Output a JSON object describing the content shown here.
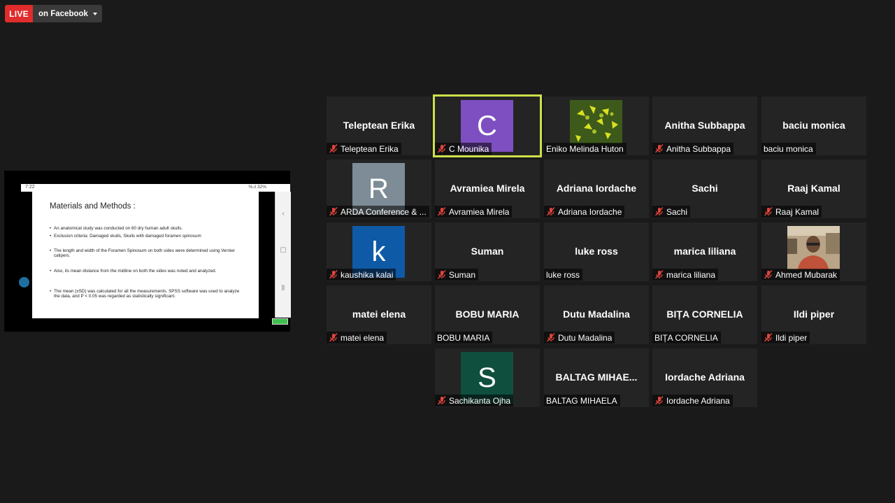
{
  "live": {
    "badge": "LIVE",
    "destination": "on Facebook"
  },
  "share": {
    "status_time": "7:22",
    "status_right": "%.ıl 32%",
    "slide_title": "Materials and Methods :",
    "bullets": [
      "An anatomical study was conducted on 60 dry human adult skulls.",
      "Exclusion criteria: Damaged skulls, Skulls with damaged foramen spinosum",
      "The length and width of the Foramen Spinosum on both sides were determined using Vernier calipers.",
      "Also, its mean distance from the midline on both the sides was noted and analyzed.",
      "The mean (±SD) was calculated for all the measurements. SPSS software was used to analyze the data, and P < 0.05 was regarded as statistically significant."
    ]
  },
  "accent_color": "#cde04a",
  "participants": [
    {
      "name": "Teleptean Erika",
      "display": "Teleptean Erika",
      "muted": true,
      "type": "name"
    },
    {
      "name": "C Mounika",
      "display": "C",
      "muted": true,
      "type": "avatar",
      "color": "#7e4fc0",
      "active": true
    },
    {
      "name": "Eniko Melinda Huton",
      "display": "",
      "muted": false,
      "type": "photo-flower"
    },
    {
      "name": "Anitha Subbappa",
      "display": "Anitha Subbappa",
      "muted": true,
      "type": "name"
    },
    {
      "name": "baciu monica",
      "display": "baciu monica",
      "muted": false,
      "type": "name"
    },
    {
      "name": "ARDA Conference & ...",
      "display": "R",
      "muted": true,
      "type": "avatar",
      "color": "#7d8c96"
    },
    {
      "name": "Avramiea Mirela",
      "display": "Avramiea Mirela",
      "muted": true,
      "type": "name"
    },
    {
      "name": "Adriana Iordache",
      "display": "Adriana Iordache",
      "muted": true,
      "type": "name"
    },
    {
      "name": "Sachi",
      "display": "Sachi",
      "muted": true,
      "type": "name"
    },
    {
      "name": "Raaj Kamal",
      "display": "Raaj Kamal",
      "muted": true,
      "type": "name"
    },
    {
      "name": "kaushika kalai",
      "display": "k",
      "muted": true,
      "type": "avatar",
      "color": "#0f5aa6"
    },
    {
      "name": "Suman",
      "display": "Suman",
      "muted": true,
      "type": "name"
    },
    {
      "name": "luke ross",
      "display": "luke ross",
      "muted": false,
      "type": "name"
    },
    {
      "name": "marica liliana",
      "display": "marica liliana",
      "muted": true,
      "type": "name"
    },
    {
      "name": "Ahmed Mubarak",
      "display": "",
      "muted": true,
      "type": "photo-person"
    },
    {
      "name": "matei elena",
      "display": "matei elena",
      "muted": true,
      "type": "name"
    },
    {
      "name": "BOBU MARIA",
      "display": "BOBU MARIA",
      "muted": false,
      "type": "name"
    },
    {
      "name": "Dutu Madalina",
      "display": "Dutu Madalina",
      "muted": true,
      "type": "name"
    },
    {
      "name": "BIȚA CORNELIA",
      "display": "BIȚA CORNELIA",
      "muted": false,
      "type": "name"
    },
    {
      "name": "Ildi piper",
      "display": "Ildi piper",
      "muted": true,
      "type": "name"
    },
    {
      "name": "Sachikanta Ojha",
      "display": "S",
      "muted": true,
      "type": "avatar",
      "color": "#0e4f3e"
    },
    {
      "name": "BALTAG MIHAELA",
      "display": "BALTAG MIHAE...",
      "muted": false,
      "type": "name"
    },
    {
      "name": "Iordache Adriana",
      "display": "Iordache Adriana",
      "muted": true,
      "type": "name"
    }
  ]
}
